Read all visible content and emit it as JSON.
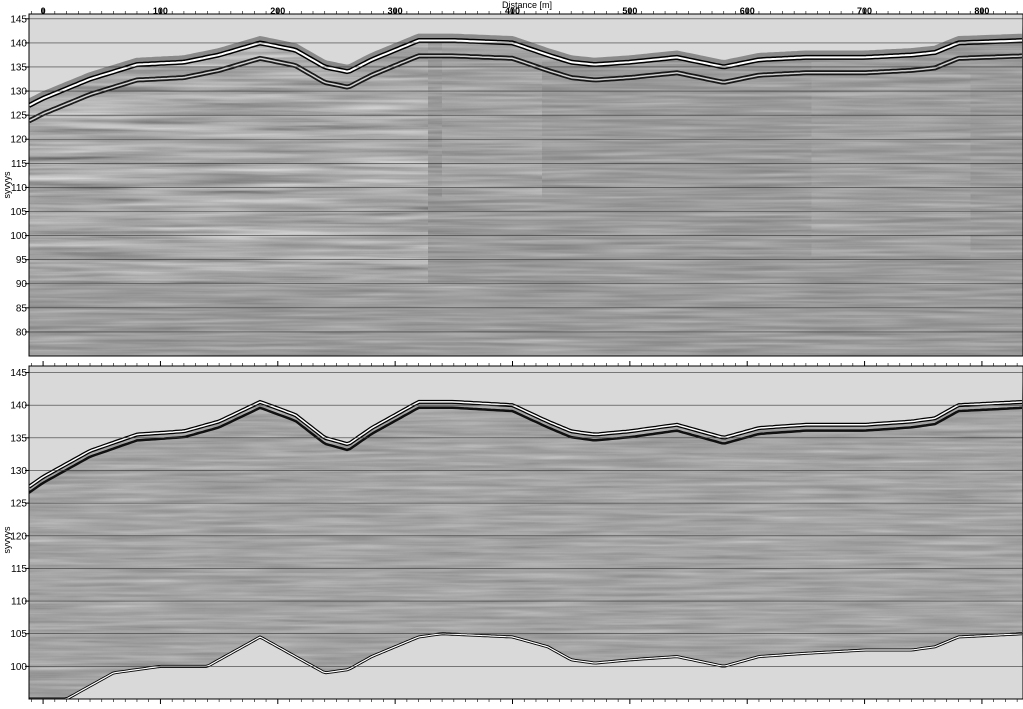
{
  "chart_data": [
    {
      "type": "heatmap",
      "panel": "upper",
      "title": "",
      "xlabel": "Distance [m]",
      "ylabel": "syvyys",
      "xlim": [
        -12,
        835
      ],
      "ylim": [
        75,
        146
      ],
      "x_ticks": [
        0,
        100,
        200,
        300,
        400,
        500,
        600,
        700,
        800
      ],
      "x_tick_labels": [
        "0",
        "100",
        "200",
        "300",
        "400",
        "500",
        "600",
        "700",
        "800"
      ],
      "y_ticks": [
        80,
        85,
        90,
        95,
        100,
        105,
        110,
        115,
        120,
        125,
        130,
        135,
        140,
        145
      ],
      "y_tick_labels": [
        "80",
        "85",
        "90",
        "95",
        "100",
        "105",
        "110",
        "115",
        "120",
        "125",
        "130",
        "135",
        "140",
        "145"
      ],
      "grid": "horizontal",
      "colormap": [
        "#000000",
        "#7d7d7d",
        "#ffffff"
      ],
      "surface_profile": {
        "x": [
          -12,
          0,
          40,
          80,
          120,
          150,
          185,
          215,
          240,
          260,
          280,
          300,
          320,
          350,
          400,
          430,
          450,
          470,
          500,
          540,
          580,
          610,
          650,
          700,
          740,
          760,
          780,
          835
        ],
        "y": [
          127,
          128.5,
          132.5,
          135.5,
          136,
          137.5,
          140,
          138.5,
          135,
          134,
          136.5,
          138.5,
          140.5,
          140.5,
          140,
          137.5,
          136,
          135.5,
          136,
          137,
          135,
          136.5,
          137,
          137,
          137.5,
          138,
          140,
          140.5
        ]
      }
    },
    {
      "type": "heatmap",
      "panel": "lower",
      "title": "",
      "xlabel": "",
      "ylabel": "syvyys",
      "xlim": [
        -12,
        835
      ],
      "ylim": [
        95,
        146
      ],
      "y_ticks": [
        100,
        105,
        110,
        115,
        120,
        125,
        130,
        135,
        140,
        145
      ],
      "y_tick_labels": [
        "100",
        "105",
        "110",
        "115",
        "120",
        "125",
        "130",
        "135",
        "140",
        "145"
      ],
      "grid": "horizontal",
      "colormap": [
        "#000000",
        "#7d7d7d",
        "#ffffff"
      ],
      "surface_profile": {
        "x": [
          -12,
          0,
          40,
          80,
          120,
          150,
          185,
          215,
          240,
          260,
          280,
          300,
          320,
          350,
          400,
          430,
          450,
          470,
          500,
          540,
          580,
          610,
          650,
          700,
          740,
          760,
          780,
          835
        ],
        "y": [
          127.5,
          129,
          133,
          135.5,
          136,
          137.5,
          140.5,
          138.5,
          135,
          134,
          136.5,
          138.5,
          140.5,
          140.5,
          140,
          137.5,
          136,
          135.5,
          136,
          137,
          135,
          136.5,
          137,
          137,
          137.5,
          138,
          140,
          140.5
        ]
      },
      "lower_boundary": {
        "x": [
          -12,
          20,
          60,
          100,
          140,
          170,
          185,
          210,
          240,
          260,
          280,
          300,
          320,
          340,
          400,
          430,
          450,
          470,
          500,
          540,
          580,
          610,
          650,
          700,
          740,
          760,
          780,
          835
        ],
        "y": [
          95,
          95,
          99,
          100,
          100,
          103,
          104.5,
          102,
          99,
          99.5,
          101.5,
          103,
          104.5,
          105,
          104.5,
          103,
          101,
          100.5,
          101,
          101.5,
          100,
          101.5,
          102,
          102.5,
          102.5,
          103,
          104.5,
          105
        ]
      }
    }
  ]
}
